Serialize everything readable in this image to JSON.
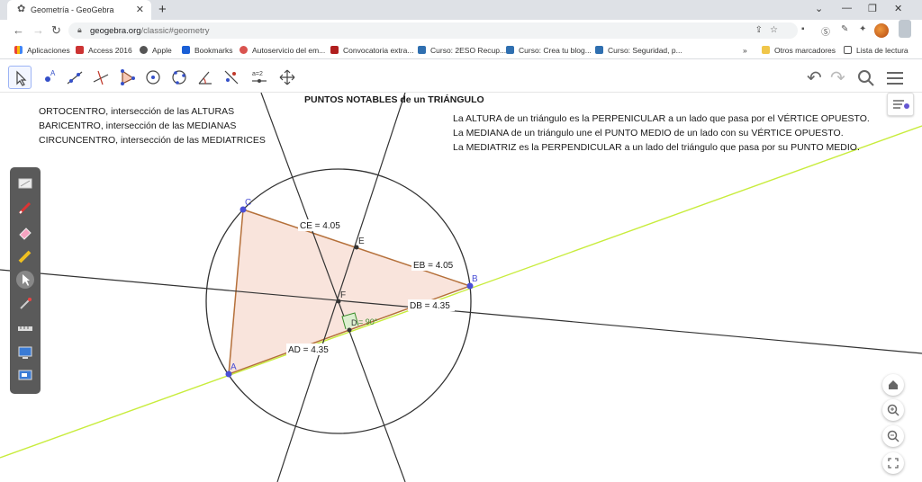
{
  "browser": {
    "tab_title": "Geometría - GeoGebra",
    "url_host": "geogebra.org",
    "url_path": "/classic#geometry",
    "bookmarks": [
      "Aplicaciones",
      "Access 2016",
      "Apple",
      "Bookmarks",
      "Autoservicio del em...",
      "Convocatoria extra...",
      "Curso: 2ESO Recup...",
      "Curso: Crea tu blog...",
      "Curso: Seguridad, p..."
    ],
    "bookmarks_overflow": "»",
    "other_bookmarks": "Otros marcadores",
    "reading_list": "Lista de lectura"
  },
  "toolbar": {
    "slider_label": "a=2"
  },
  "canvas": {
    "title": "PUNTOS NOTABLES de un TRIÁNGULO",
    "left_notes": [
      "ORTOCENTRO, intersección de las ALTURAS",
      "BARICENTRO, intersección de las MEDIANAS",
      "CIRCUNCENTRO, intersección de las MEDIATRICES"
    ],
    "right_notes": [
      "La ALTURA de un triángulo es la PERPENICULAR a un lado que pasa por el VÉRTICE OPUESTO.",
      "La MEDIANA de un triángulo une el PUNTO MEDIO de un lado con su VÉRTICE OPUESTO.",
      "La MEDIATRIZ es la PERPENDICULAR a un lado del triángulo que pasa por su PUNTO MEDIO."
    ],
    "points": {
      "A": "A",
      "B": "B",
      "C": "C",
      "D": "D",
      "E": "E",
      "F": "F"
    },
    "measures": {
      "ce": "CE = 4.05",
      "eb": "EB = 4.05",
      "db": "DB = 4.35",
      "ad": "AD = 4.35",
      "angle": "= 90°"
    }
  },
  "colors": {
    "triangle_fill": "#f9e4dc",
    "triangle_edge": "#b5703a",
    "point": "#4a4fd6",
    "green_line": "#c8ec3c",
    "sidebar": "#5a5a5a",
    "selected_tool": "#9db4f5"
  }
}
